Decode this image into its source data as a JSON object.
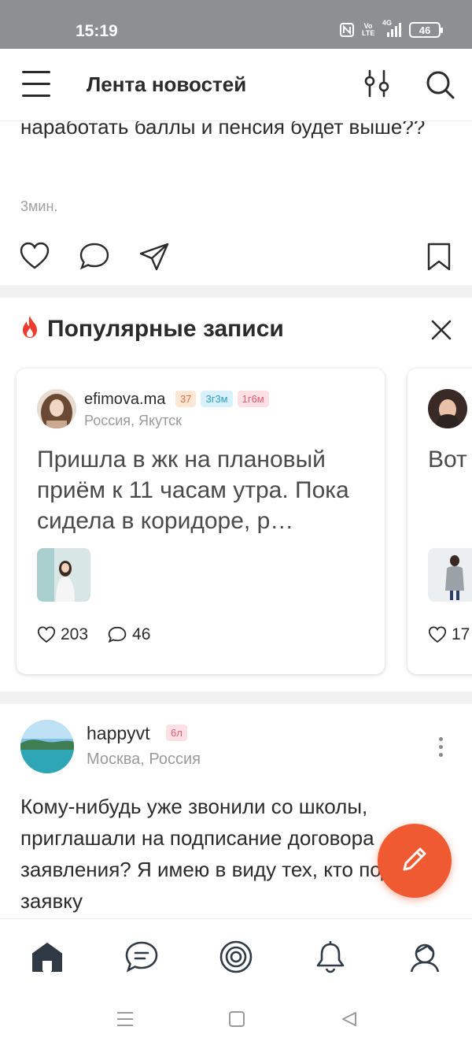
{
  "status_bar": {
    "time": "15:19",
    "battery": "46",
    "network": "4G",
    "volte": "Vo LTE"
  },
  "header": {
    "title": "Лента новостей"
  },
  "previous_post": {
    "text": "наработать баллы и пенсия будет выше??",
    "time": "3мин."
  },
  "popular": {
    "title": "Популярные записи",
    "cards": [
      {
        "username": "efimova.ma",
        "badges": [
          "37",
          "3г3м",
          "1г6м"
        ],
        "location": "Россия, Якутск",
        "text": "Пришла в жк на плановый приём к 11 часам утра. Пока сидела в коридоре, р…",
        "likes": "203",
        "comments": "46"
      },
      {
        "text": "Вот пал Как",
        "likes": "17"
      }
    ]
  },
  "post": {
    "username": "happyvt",
    "badge": "6л",
    "location": "Москва, Россия",
    "text": "Кому-нибудь уже звонили со школы, приглашали на подписание договора заявления? Я имею в виду тех, кто подавал заявку"
  },
  "colors": {
    "accent": "#ef5a32",
    "badge_orange": "#ffe7d6",
    "badge_blue": "#d9f1fb",
    "badge_pink": "#fde0e4"
  },
  "icons": [
    "menu-icon",
    "filter-icon",
    "search-icon",
    "heart-icon",
    "comment-icon",
    "share-icon",
    "bookmark-icon",
    "fire-icon",
    "close-icon",
    "pencil-icon",
    "home-icon",
    "chat-icon",
    "target-icon",
    "bell-icon",
    "profile-icon"
  ]
}
